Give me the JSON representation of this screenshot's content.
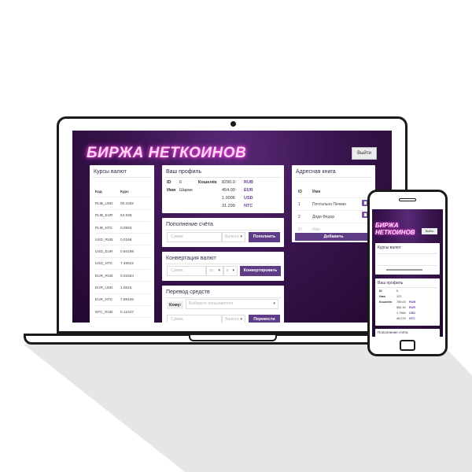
{
  "app": {
    "title": "БИРЖА НЕТКОИНОВ",
    "logout_label": "Выйти"
  },
  "rates": {
    "title": "Курсы валют",
    "headers": [
      "Код",
      "Курс"
    ],
    "rows": [
      [
        "RUB_USD",
        "00.2282"
      ],
      [
        "RUB_EUR",
        "63.938"
      ],
      [
        "RUB_NTC",
        "0.0993"
      ],
      [
        "USD_RUB",
        "0.0166"
      ],
      [
        "USD_EUR",
        "0.94198"
      ],
      [
        "USD_NTC",
        "7.45622"
      ],
      [
        "EUR_RUB",
        "0.01564"
      ],
      [
        "EUR_USD",
        "1.0616"
      ],
      [
        "EUR_NTC",
        "7.89426"
      ],
      [
        "NTC_RUB",
        "0.12347"
      ],
      [
        "NTC_USD",
        "0.13448"
      ],
      [
        "NTC_EUR",
        "0.12667"
      ]
    ]
  },
  "profile": {
    "title": "Ваш профиль",
    "id_label": "ID",
    "id_value": "6",
    "name_label": "Имя",
    "name_value": "Шарик",
    "wallet_label": "Кошелёк",
    "balances": [
      {
        "amount": "8290.0",
        "currency": "RUB"
      },
      {
        "amount": "454.00",
        "currency": "EUR"
      },
      {
        "amount": "1.0006",
        "currency": "USD"
      },
      {
        "amount": "31.299",
        "currency": "NTC"
      }
    ]
  },
  "deposit": {
    "title": "Пополнение счёта",
    "amount_placeholder": "Сумма",
    "currency_placeholder": "Валюта",
    "button": "Пополнить"
  },
  "convert": {
    "title": "Конвертация валют",
    "amount_placeholder": "Сумма",
    "from_value": "из",
    "to_value": "в",
    "button": "Конвертировать"
  },
  "transfer": {
    "title": "Перевод средств",
    "to_label": "Кому:",
    "user_placeholder": "Выберите пользователя",
    "amount_placeholder": "Сумма",
    "currency_placeholder": "Валюта",
    "button": "Перевести"
  },
  "addressbook": {
    "title": "Адресная книга",
    "headers": [
      "ID",
      "Имя"
    ],
    "rows": [
      [
        "1",
        "Почтальон Печкин"
      ],
      [
        "2",
        "Дядя Фёдор"
      ]
    ],
    "new_id_placeholder": "ID",
    "new_name_placeholder": "Имя",
    "add_button": "Добавить"
  },
  "mobile": {
    "title": "БИРЖА НЕТКОИНОВ",
    "logout_label": "Выйти",
    "rates_title": "Курсы валют",
    "profile_title": "Ваш профиль",
    "id_label": "ID",
    "id_value": "5",
    "name_label": "Имя",
    "name_value": "123",
    "wallet_label": "Кошелёк",
    "balances": [
      {
        "amount": "759.00",
        "currency": "RUB"
      },
      {
        "amount": "584.15",
        "currency": "EUR"
      },
      {
        "amount": "1.7966",
        "currency": "USD"
      },
      {
        "amount": "46.078",
        "currency": "NTC"
      }
    ],
    "deposit_title": "Пополнение счёта"
  },
  "colors": {
    "accent": "#5f3c86",
    "neon": "#ff4fd8",
    "bg_dark": "#22082f"
  }
}
